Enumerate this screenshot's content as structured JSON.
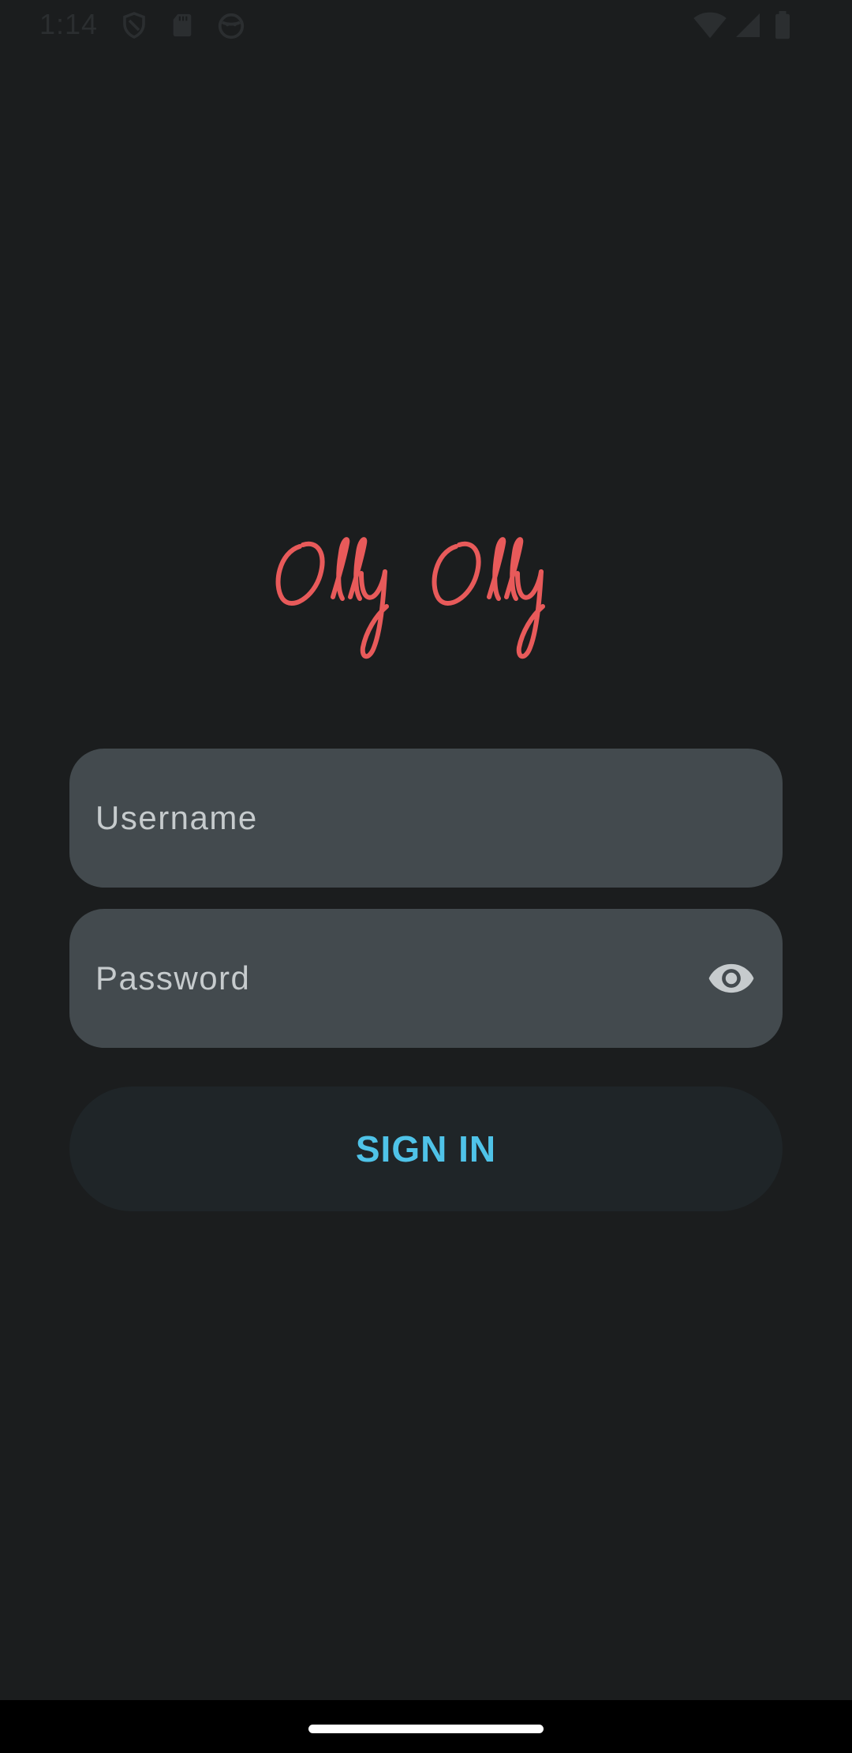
{
  "status_bar": {
    "time": "1:14",
    "left_icons": [
      "shield-icon",
      "sd-card-icon",
      "face-icon"
    ],
    "right_icons": [
      "wifi-icon",
      "signal-icon",
      "battery-icon"
    ]
  },
  "app": {
    "logo_text": "Olly Olly",
    "logo_color": "#e85a5a"
  },
  "form": {
    "username_placeholder": "Username",
    "password_placeholder": "Password",
    "password_toggle_icon": "eye-icon",
    "sign_in_label": "SIGN IN",
    "accent_color": "#4fc3e8"
  }
}
